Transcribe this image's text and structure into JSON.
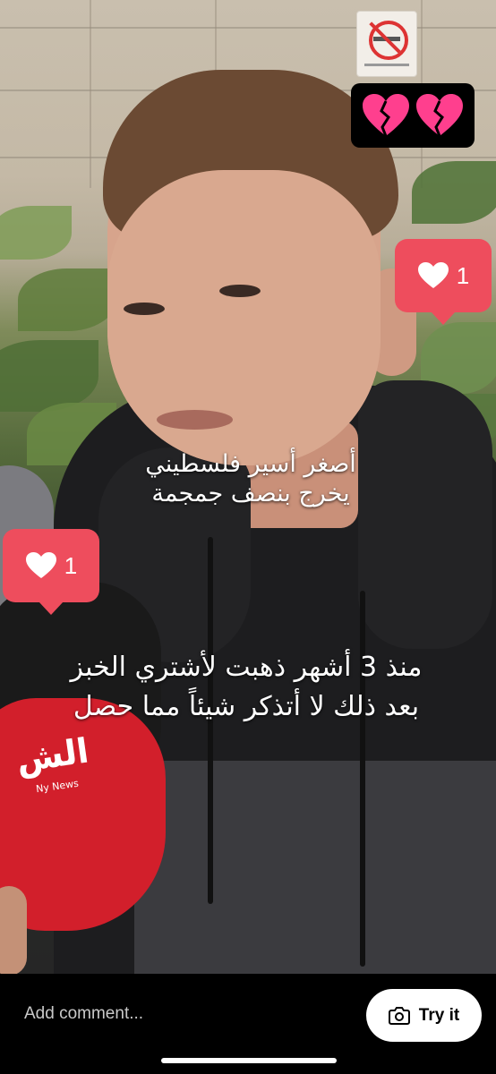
{
  "video": {
    "caption_title_line1": "أصغر أسير فلسطيني",
    "caption_title_line2": "يخرج بنصف جمجمة",
    "caption_quote_line1": "منذ 3 أشهر ذهبت لأشتري الخبز",
    "caption_quote_line2": "بعد ذلك لا أتذكر شيئاً مما حصل",
    "sticker_icon": "broken-heart-icon",
    "mic_logo": "الش",
    "mic_sub": "Ny News",
    "like_bubbles": [
      {
        "count": "1",
        "icon": "heart-icon"
      },
      {
        "count": "1",
        "icon": "heart-icon"
      }
    ]
  },
  "bottom_bar": {
    "comment_placeholder": "Add comment...",
    "try_it_label": "Try it",
    "try_it_icon": "camera-icon"
  },
  "colors": {
    "like_bubble": "#ee4d5d",
    "background": "#000000",
    "try_button_bg": "#ffffff"
  }
}
